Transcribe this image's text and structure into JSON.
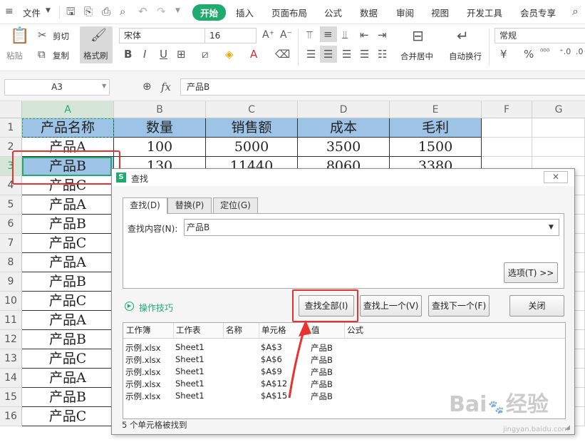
{
  "menubar": {
    "file_label": "文件",
    "tabs": [
      "开始",
      "插入",
      "页面布局",
      "公式",
      "数据",
      "审阅",
      "视图",
      "开发工具",
      "会员专享"
    ]
  },
  "ribbon": {
    "paste": "粘贴",
    "cut": "剪切",
    "copy": "复制",
    "format_painter": "格式刷",
    "font_name": "宋体",
    "font_size": "16",
    "merge_center": "合并居中",
    "wrap_text": "自动换行",
    "number_format": "常规"
  },
  "formula_bar": {
    "name_box": "A3",
    "fx": "fx",
    "content": "产品B"
  },
  "sheet": {
    "columns": [
      "A",
      "B",
      "C",
      "D",
      "E",
      "F",
      "G"
    ],
    "rows": [
      "1",
      "2",
      "3",
      "4",
      "5",
      "6",
      "7",
      "8",
      "9",
      "10",
      "11",
      "12",
      "13",
      "14",
      "15",
      "16"
    ],
    "header_row": [
      "产品名称",
      "数量",
      "销售额",
      "成本",
      "毛利"
    ],
    "row2": [
      "产品A",
      "100",
      "5000",
      "3500",
      "1500"
    ],
    "row3": [
      "产品B",
      "130",
      "11440",
      "8060",
      "3380"
    ],
    "col_a": [
      "产品C",
      "产品A",
      "产品B",
      "产品C",
      "产品A",
      "产品B",
      "产品C",
      "产品A",
      "产品B",
      "产品C",
      "产品A",
      "产品B",
      "产品C"
    ],
    "header_fill": "#9dc3e6",
    "selection_color": "#1faa6e",
    "highlight_color": "#e8322e"
  },
  "dialog": {
    "title": "查找",
    "tabs": [
      "查找(D)",
      "替换(P)",
      "定位(G)"
    ],
    "find_label": "查找内容(N):",
    "find_value": "产品B",
    "options_button": "选项(T) >>",
    "tips_link": "操作技巧",
    "find_all": "查找全部(I)",
    "find_prev": "查找上一个(V)",
    "find_next": "查找下一个(F)",
    "close": "关闭",
    "result_headers": [
      "工作簿",
      "工作表",
      "名称",
      "单元格",
      "值",
      "公式"
    ],
    "results": [
      {
        "book": "示例.xlsx",
        "sheet": "Sheet1",
        "cell": "$A$3",
        "value": "产品B"
      },
      {
        "book": "示例.xlsx",
        "sheet": "Sheet1",
        "cell": "$A$6",
        "value": "产品B"
      },
      {
        "book": "示例.xlsx",
        "sheet": "Sheet1",
        "cell": "$A$9",
        "value": "产品B"
      },
      {
        "book": "示例.xlsx",
        "sheet": "Sheet1",
        "cell": "$A$12",
        "value": "产品B"
      },
      {
        "book": "示例.xlsx",
        "sheet": "Sheet1",
        "cell": "$A$15",
        "value": "产品B"
      }
    ],
    "status": "5 个单元格被找到"
  },
  "watermark": {
    "text1": "Bai",
    "text2": "经验",
    "url": "jingyan.baidu.com"
  }
}
